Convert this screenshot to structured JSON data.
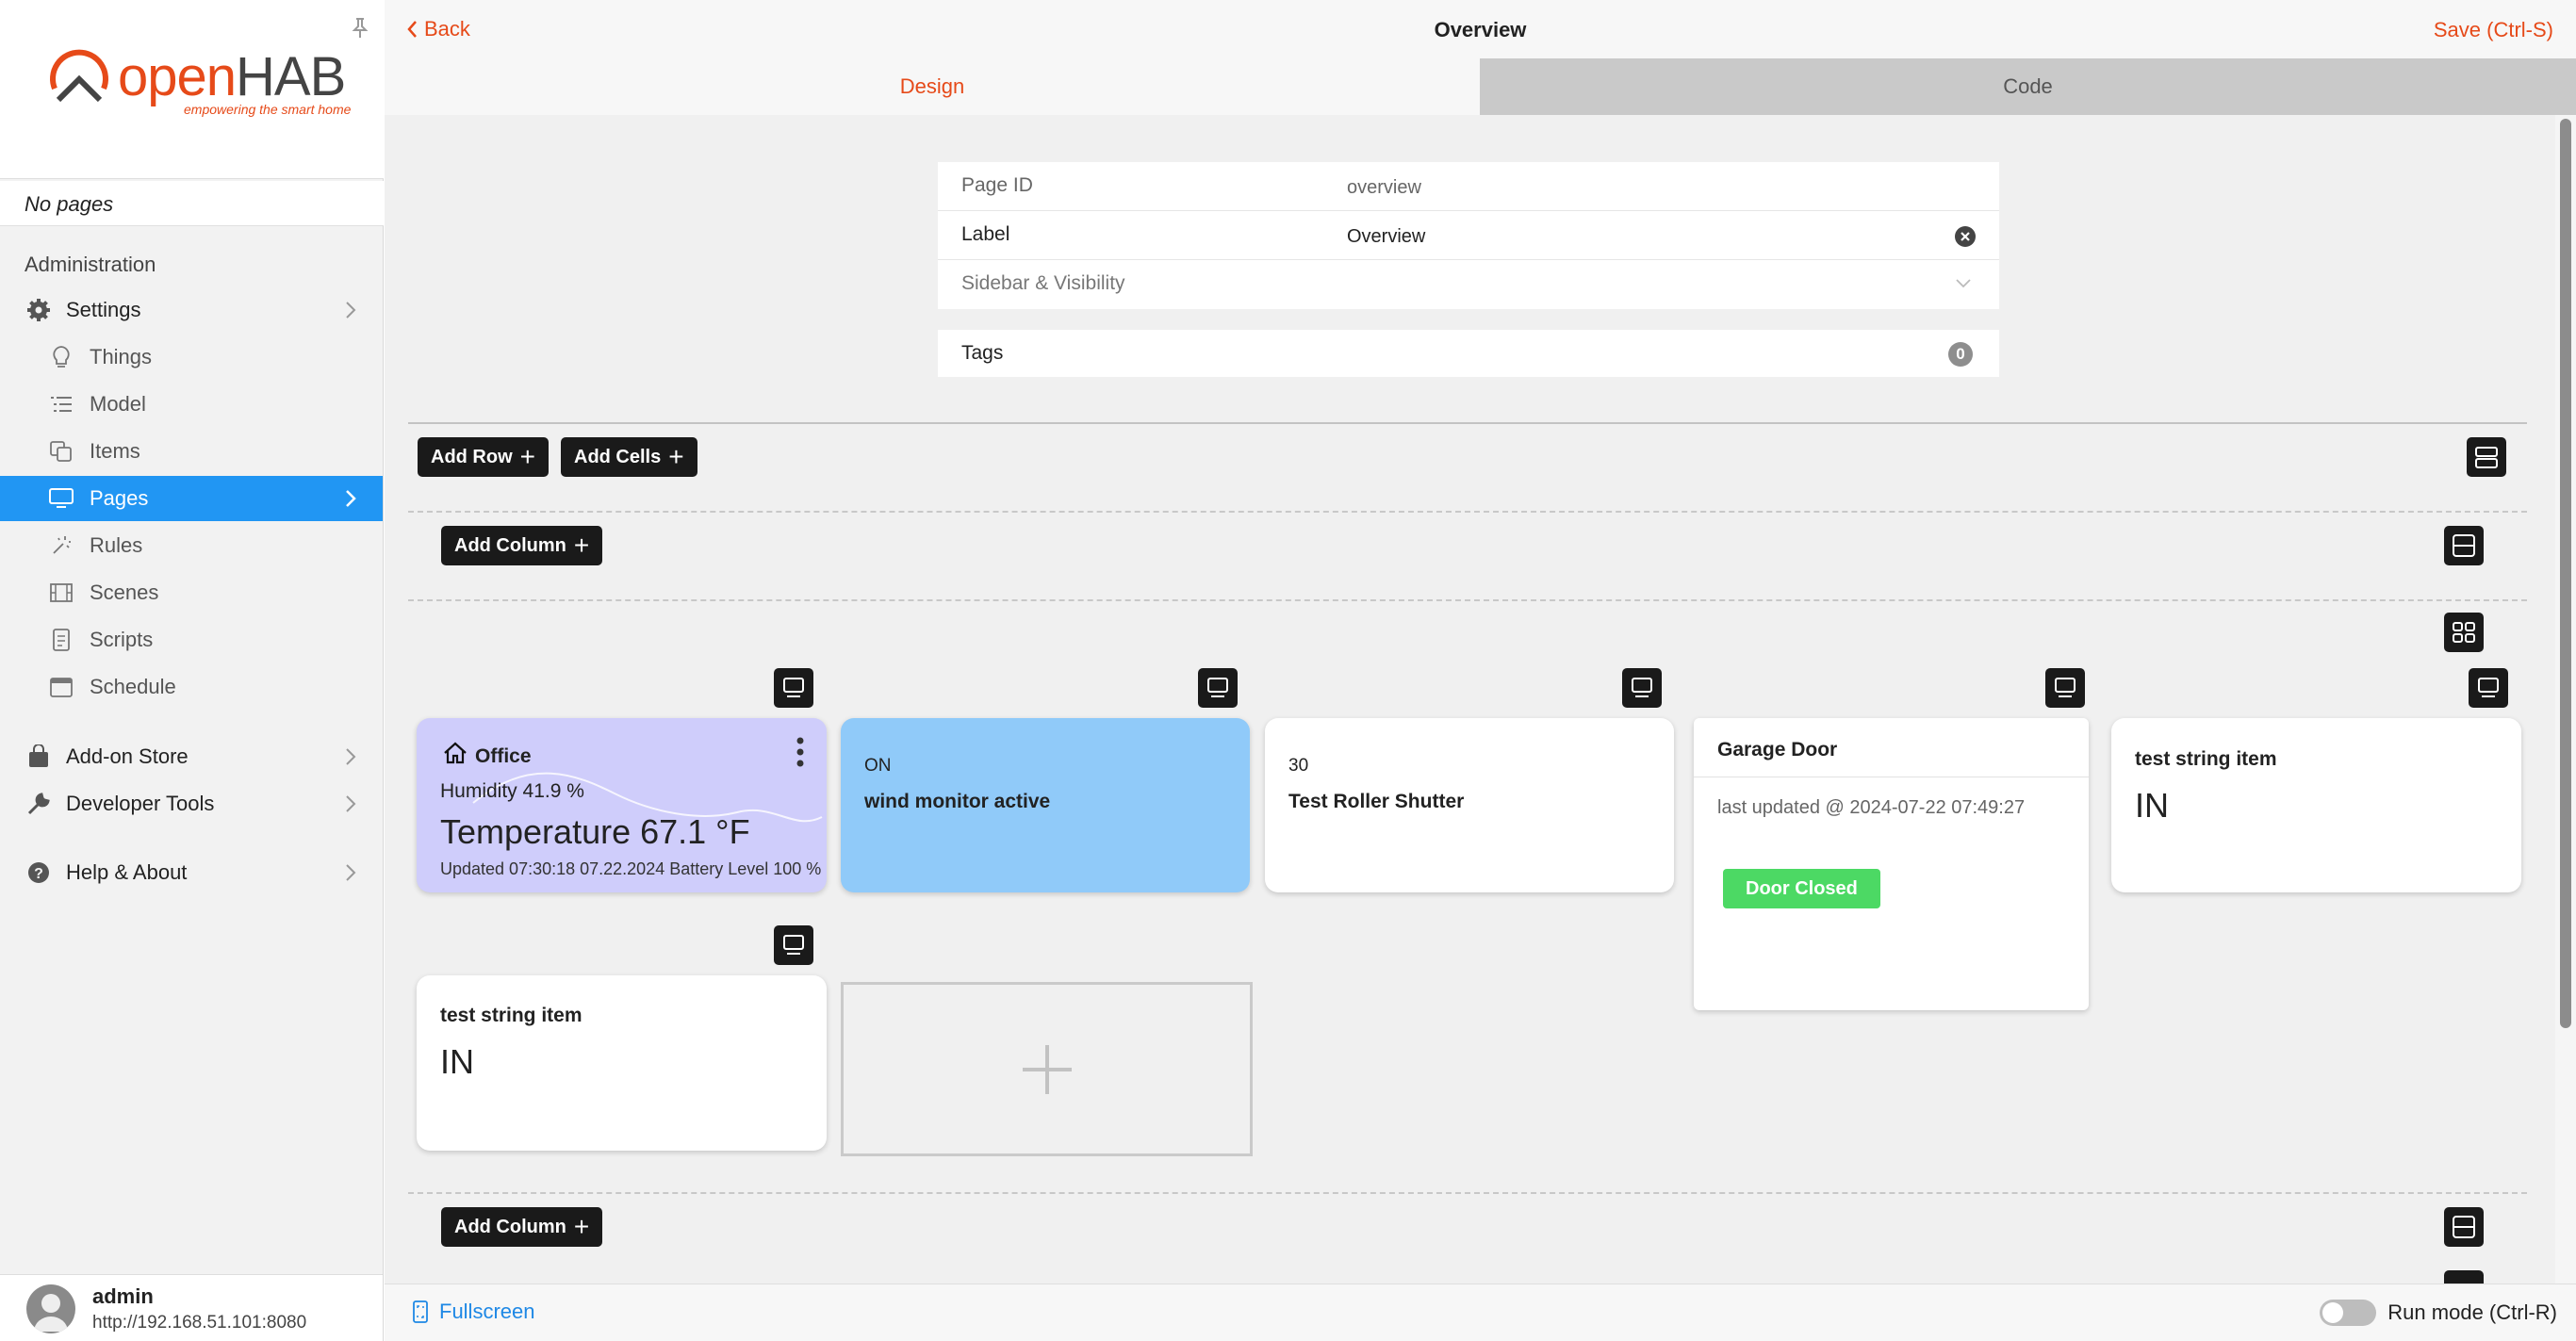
{
  "brand": {
    "name_prefix": "open",
    "name_suffix": "HAB",
    "tagline": "empowering the smart home"
  },
  "sidebar": {
    "no_pages": "No pages",
    "section_title": "Administration",
    "items": [
      {
        "label": "Settings",
        "icon": "gear-icon"
      },
      {
        "label": "Things",
        "icon": "lightbulb-icon"
      },
      {
        "label": "Model",
        "icon": "list-icon"
      },
      {
        "label": "Items",
        "icon": "items-icon"
      },
      {
        "label": "Pages",
        "icon": "monitor-icon",
        "active": true
      },
      {
        "label": "Rules",
        "icon": "wand-icon"
      },
      {
        "label": "Scenes",
        "icon": "film-icon"
      },
      {
        "label": "Scripts",
        "icon": "script-icon"
      },
      {
        "label": "Schedule",
        "icon": "calendar-icon"
      },
      {
        "label": "Add-on Store",
        "icon": "bag-icon"
      },
      {
        "label": "Developer Tools",
        "icon": "wrench-icon"
      },
      {
        "label": "Help & About",
        "icon": "help-icon"
      }
    ],
    "user": {
      "name": "admin",
      "url": "http://192.168.51.101:8080"
    }
  },
  "topbar": {
    "back": "Back",
    "title": "Overview",
    "save": "Save (Ctrl-S)"
  },
  "tabs": {
    "design": "Design",
    "code": "Code"
  },
  "form": {
    "page_id_label": "Page ID",
    "page_id_value": "overview",
    "label_label": "Label",
    "label_value": "Overview",
    "sidebar_visibility": "Sidebar & Visibility",
    "tags_label": "Tags",
    "tags_count": "0"
  },
  "toolbar": {
    "add_row": "Add Row",
    "add_cells": "Add Cells",
    "add_column": "Add Column"
  },
  "cards": {
    "office": {
      "title": "Office",
      "humidity": "Humidity 41.9 %",
      "temperature": "Temperature 67.1 °F",
      "footer": "Updated 07:30:18 07.22.2024 Battery Level 100 %"
    },
    "wind": {
      "state": "ON",
      "title": "wind monitor active"
    },
    "shutter": {
      "state": "30",
      "title": "Test Roller Shutter"
    },
    "garage": {
      "title": "Garage Door",
      "updated": "last updated @ 2024-07-22 07:49:27",
      "badge": "Door Closed"
    },
    "string1": {
      "title": "test string item",
      "value": "IN"
    },
    "string2": {
      "title": "test string item",
      "value": "IN"
    }
  },
  "bottombar": {
    "fullscreen": "Fullscreen",
    "run_mode": "Run mode (Ctrl-R)"
  },
  "colors": {
    "accent": "#e64a19",
    "active_nav": "#2196f3",
    "office_card": "#cfcdfb",
    "wind_card": "#90caf9",
    "door_badge": "#4cd964"
  }
}
